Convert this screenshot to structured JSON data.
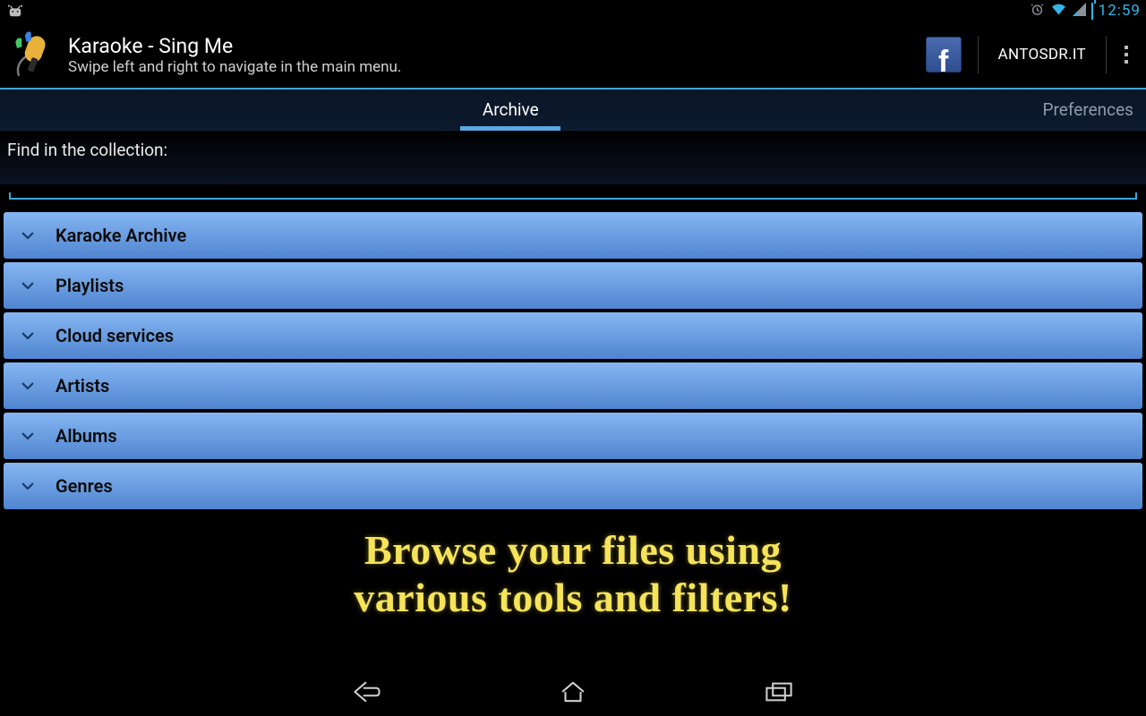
{
  "statusbar": {
    "time": "12:59"
  },
  "header": {
    "title": "Karaoke - Sing Me",
    "subtitle": "Swipe left and right to navigate in the main menu.",
    "brand": "ANTOSDR.IT"
  },
  "tabs": {
    "center": "Archive",
    "right": "Preferences"
  },
  "search": {
    "label": "Find in the collection:",
    "value": ""
  },
  "categories": [
    {
      "label": "Karaoke Archive"
    },
    {
      "label": "Playlists"
    },
    {
      "label": "Cloud services"
    },
    {
      "label": "Artists"
    },
    {
      "label": "Albums"
    },
    {
      "label": "Genres"
    }
  ],
  "promo": {
    "line1": "Browse your files using",
    "line2": "various tools and filters!"
  },
  "colors": {
    "accent": "#33b5e5",
    "category": "#5d92da",
    "promo": "#f5e35a"
  }
}
